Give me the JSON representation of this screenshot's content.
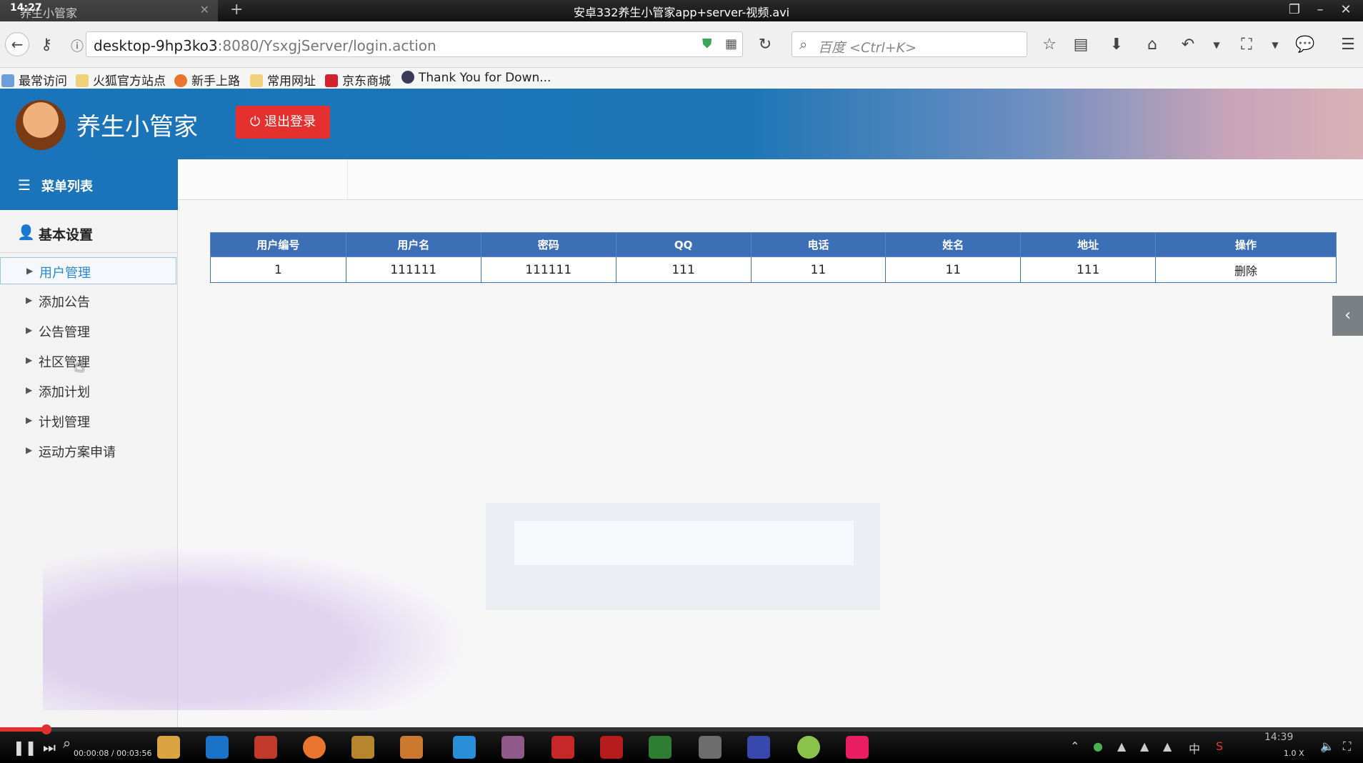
{
  "player": {
    "clock": "14:27",
    "filename": "安卓332养生小管家app+server-视频.avi",
    "elapsed": "00:00:08",
    "total": "00:03:56",
    "progress": 0.034,
    "tray_time": "14:39",
    "speed": "1.0 X",
    "ime": "中",
    "colors": {
      "progress": "#e0302f"
    }
  },
  "browser": {
    "tab_title": "养生小管家",
    "url_host": "desktop-9hp3ko3",
    "url_rest": ":8080/YsxgjServer/login.action",
    "search_placeholder": "百度 <Ctrl+K>",
    "bookmarks": [
      "最常访问",
      "火狐官方站点",
      "新手上路",
      "常用网址",
      "京东商城",
      "Thank You for Down..."
    ]
  },
  "app": {
    "title": "养生小管家",
    "logout_label": "退出登录",
    "menu_header": "菜单列表",
    "group_label": "基本设置",
    "menu_items": [
      "用户管理",
      "添加公告",
      "公告管理",
      "社区管理",
      "添加计划",
      "计划管理",
      "运动方案申请"
    ],
    "active_item": "用户管理",
    "colors": {
      "header": "#1b74b9",
      "logout": "#e4302f",
      "table_header": "#3d6fb7"
    }
  },
  "table": {
    "columns": [
      "用户编号",
      "用户名",
      "密码",
      "QQ",
      "电话",
      "姓名",
      "地址",
      "操作"
    ],
    "rows": [
      [
        "1",
        "111111",
        "111111",
        "111",
        "11",
        "11",
        "111",
        "删除"
      ]
    ]
  }
}
